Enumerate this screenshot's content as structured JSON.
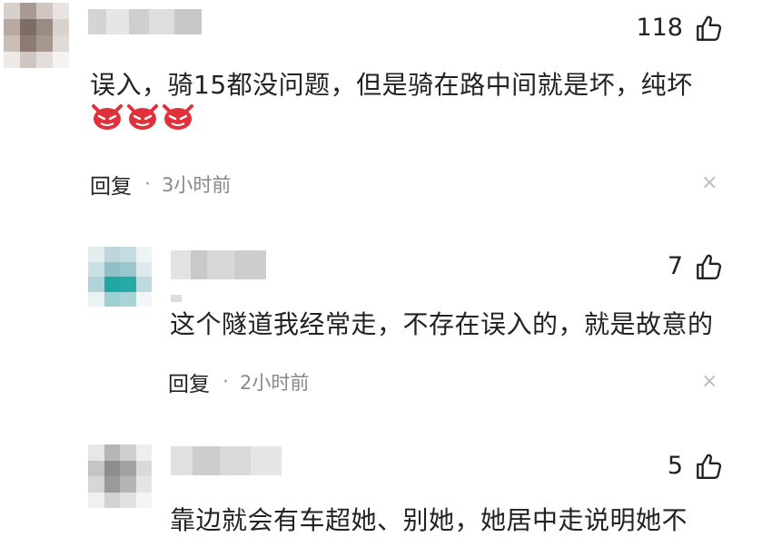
{
  "comments": [
    {
      "likes": "118",
      "text": "误入，骑15都没问题，但是骑在路中间就是坏，纯坏",
      "emoji": [
        "devil-face-icon",
        "devil-face-icon",
        "devil-face-icon"
      ],
      "reply_label": "回复",
      "separator": "·",
      "time": "3小时前",
      "close_glyph": "×"
    },
    {
      "likes": "7",
      "text": "这个隧道我经常走，不存在误入的，就是故意的",
      "reply_label": "回复",
      "separator": "·",
      "time": "2小时前",
      "close_glyph": "×"
    },
    {
      "likes": "5",
      "text": "靠边就会有车超她、别她，她居中走说明她不"
    }
  ],
  "colors": {
    "text": "#222222",
    "meta": "#888888",
    "devil": "#e0303a"
  }
}
